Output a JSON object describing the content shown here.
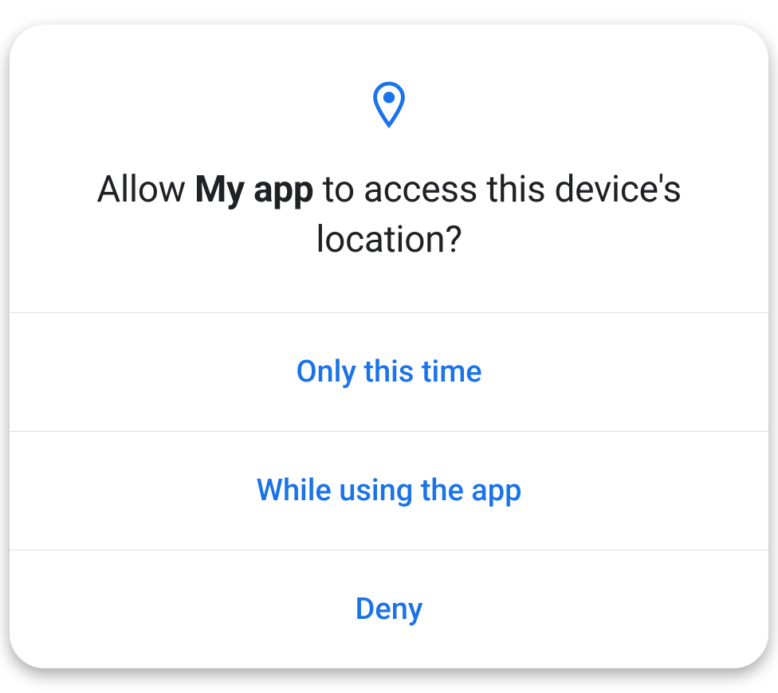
{
  "dialog": {
    "icon": "location-pin-icon",
    "title": {
      "prefix": "Allow ",
      "app_name": "My app",
      "suffix": " to access this device's location?"
    },
    "options": [
      {
        "label": "Only this time"
      },
      {
        "label": "While using the app"
      },
      {
        "label": "Deny"
      }
    ],
    "colors": {
      "accent": "#1a73e8",
      "text": "#202124",
      "divider": "#e0e0e0"
    }
  }
}
